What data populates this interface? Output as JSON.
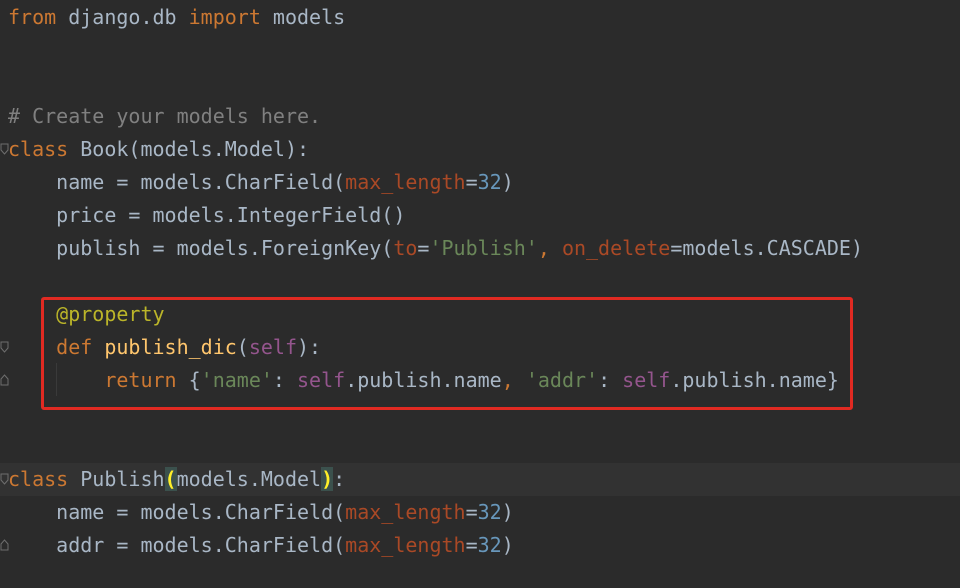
{
  "editor": {
    "lines": [
      {
        "tokens": [
          {
            "text": "from",
            "cls": "kw"
          },
          {
            "text": " django.db ",
            "cls": "tx"
          },
          {
            "text": "import",
            "cls": "kw"
          },
          {
            "text": " ",
            "cls": "tx"
          },
          {
            "text": "models",
            "cls": "tx"
          }
        ]
      },
      {
        "tokens": []
      },
      {
        "tokens": []
      },
      {
        "tokens": [
          {
            "text": "# Create your models here.",
            "cls": "cm"
          }
        ]
      },
      {
        "tokens": [
          {
            "text": "class",
            "cls": "kw"
          },
          {
            "text": " Book(",
            "cls": "tx"
          },
          {
            "text": "models",
            "cls": "tx"
          },
          {
            "text": ".Model):",
            "cls": "tx"
          }
        ]
      },
      {
        "tokens": [
          {
            "text": "    name = ",
            "cls": "tx"
          },
          {
            "text": "models",
            "cls": "tx"
          },
          {
            "text": ".CharField(",
            "cls": "tx"
          },
          {
            "text": "max_length",
            "cls": "pm"
          },
          {
            "text": "=",
            "cls": "tx"
          },
          {
            "text": "32",
            "cls": "nm"
          },
          {
            "text": ")",
            "cls": "tx"
          }
        ]
      },
      {
        "tokens": [
          {
            "text": "    price = ",
            "cls": "tx"
          },
          {
            "text": "models",
            "cls": "tx"
          },
          {
            "text": ".IntegerField()",
            "cls": "tx"
          }
        ]
      },
      {
        "tokens": [
          {
            "text": "    publish = ",
            "cls": "tx"
          },
          {
            "text": "models",
            "cls": "tx"
          },
          {
            "text": ".ForeignKey(",
            "cls": "tx"
          },
          {
            "text": "to",
            "cls": "pm"
          },
          {
            "text": "=",
            "cls": "tx"
          },
          {
            "text": "'Publish'",
            "cls": "st"
          },
          {
            "text": ", ",
            "cls": "kw"
          },
          {
            "text": "on_delete",
            "cls": "pm"
          },
          {
            "text": "=",
            "cls": "tx"
          },
          {
            "text": "models",
            "cls": "tx"
          },
          {
            "text": ".CASCADE)",
            "cls": "tx"
          }
        ]
      },
      {
        "tokens": []
      },
      {
        "tokens": [
          {
            "text": "    ",
            "cls": "tx"
          },
          {
            "text": "@property",
            "cls": "dc"
          }
        ]
      },
      {
        "tokens": [
          {
            "text": "    ",
            "cls": "tx"
          },
          {
            "text": "def",
            "cls": "kw"
          },
          {
            "text": " ",
            "cls": "tx"
          },
          {
            "text": "publish_dic",
            "cls": "fn"
          },
          {
            "text": "(",
            "cls": "tx"
          },
          {
            "text": "self",
            "cls": "sf"
          },
          {
            "text": "):",
            "cls": "tx"
          }
        ]
      },
      {
        "tokens": [
          {
            "text": "        ",
            "cls": "tx"
          },
          {
            "text": "return",
            "cls": "kw"
          },
          {
            "text": " {",
            "cls": "tx"
          },
          {
            "text": "'name'",
            "cls": "st"
          },
          {
            "text": ": ",
            "cls": "tx"
          },
          {
            "text": "self",
            "cls": "sf"
          },
          {
            "text": ".publish.name",
            "cls": "tx"
          },
          {
            "text": ", ",
            "cls": "kw"
          },
          {
            "text": "'addr'",
            "cls": "st"
          },
          {
            "text": ": ",
            "cls": "tx"
          },
          {
            "text": "self",
            "cls": "sf"
          },
          {
            "text": ".publish.name}",
            "cls": "tx"
          }
        ]
      },
      {
        "tokens": []
      },
      {
        "tokens": []
      },
      {
        "caret": true,
        "tokens": [
          {
            "text": "class",
            "cls": "kw"
          },
          {
            "text": " Publish",
            "cls": "tx"
          },
          {
            "text": "(",
            "cls": "br"
          },
          {
            "text": "models",
            "cls": "tx"
          },
          {
            "text": ".Model",
            "cls": "tx"
          },
          {
            "text": ")",
            "cls": "br"
          },
          {
            "text": ":",
            "cls": "tx"
          }
        ]
      },
      {
        "tokens": [
          {
            "text": "    name = ",
            "cls": "tx"
          },
          {
            "text": "models",
            "cls": "tx"
          },
          {
            "text": ".CharField(",
            "cls": "tx"
          },
          {
            "text": "max_length",
            "cls": "pm"
          },
          {
            "text": "=",
            "cls": "tx"
          },
          {
            "text": "32",
            "cls": "nm"
          },
          {
            "text": ")",
            "cls": "tx"
          }
        ]
      },
      {
        "tokens": [
          {
            "text": "    addr = ",
            "cls": "tx"
          },
          {
            "text": "models",
            "cls": "tx"
          },
          {
            "text": ".CharField(",
            "cls": "tx"
          },
          {
            "text": "max_length",
            "cls": "pm"
          },
          {
            "text": "=",
            "cls": "tx"
          },
          {
            "text": "32",
            "cls": "nm"
          },
          {
            "text": ")",
            "cls": "tx"
          }
        ]
      }
    ]
  },
  "colors": {
    "background": "#2b2b2b",
    "highlight_box": "#e02a22"
  }
}
